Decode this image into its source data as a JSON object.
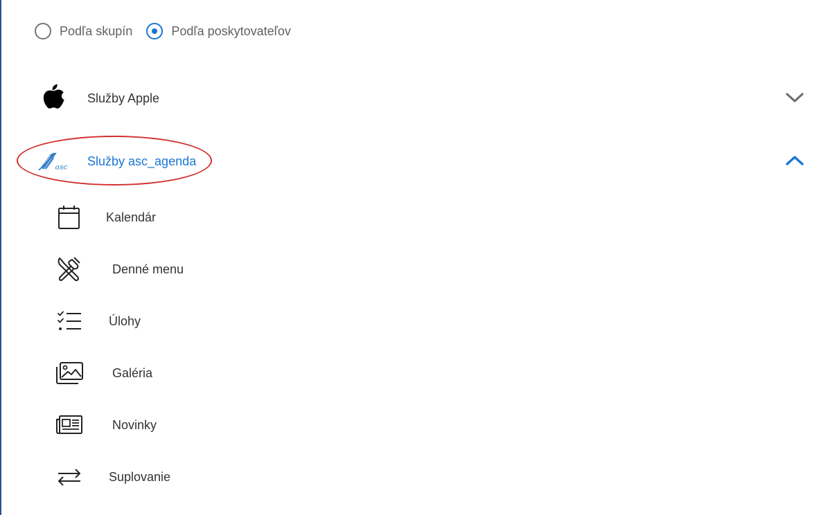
{
  "view_mode": {
    "options": [
      {
        "label": "Podľa skupín",
        "selected": false
      },
      {
        "label": "Podľa poskytovateľov",
        "selected": true
      }
    ]
  },
  "providers": [
    {
      "label": "Služby Apple",
      "logo": "apple-logo",
      "expanded": false,
      "chevron": "chevron-down-icon"
    },
    {
      "label": "Služby asc_agenda",
      "logo": "asc-agenda-logo",
      "logo_text": "asc",
      "expanded": true,
      "chevron": "chevron-up-icon",
      "services": [
        {
          "label": "Kalendár",
          "icon": "calendar-icon"
        },
        {
          "label": "Denné menu",
          "icon": "utensils-icon"
        },
        {
          "label": "Úlohy",
          "icon": "checklist-icon"
        },
        {
          "label": "Galéria",
          "icon": "gallery-icon"
        },
        {
          "label": "Novinky",
          "icon": "newspaper-icon"
        },
        {
          "label": "Suplovanie",
          "icon": "swap-arrows-icon"
        }
      ]
    }
  ],
  "colors": {
    "accent": "#1976d2",
    "highlight": "#d32f2f",
    "text": "#333333",
    "muted": "#616161",
    "chevron_collapsed": "#6e6e6e"
  }
}
